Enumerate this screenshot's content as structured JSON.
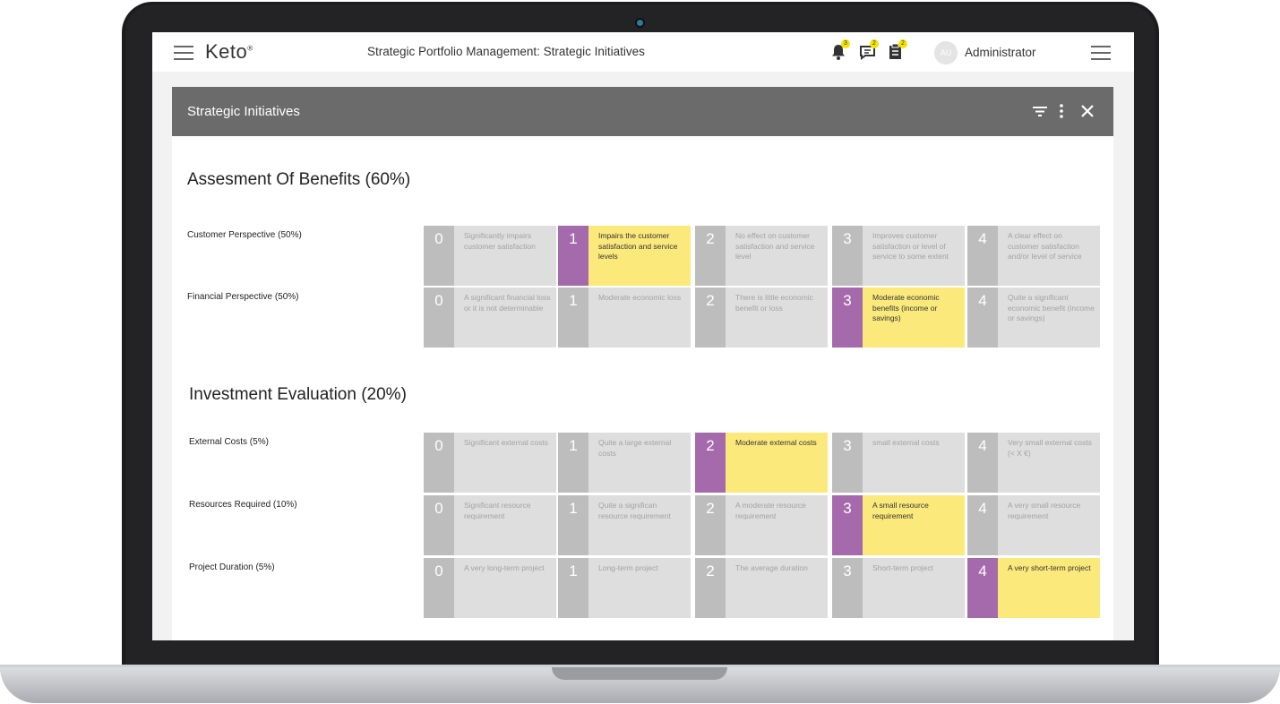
{
  "app": {
    "logo": "Keto",
    "logo_mark": "®",
    "title": "Strategic Portfolio Management: Strategic Initiatives",
    "notifications": {
      "bell": "3",
      "messages": "2",
      "tasks": "2"
    },
    "user": {
      "initials": "AU",
      "name": "Administrator"
    }
  },
  "panel": {
    "title": "Strategic Initiatives"
  },
  "sections": [
    {
      "title": "Assesment Of Benefits (60%)",
      "criteria": [
        {
          "label": "Customer Perspective (50%)",
          "selected": 1,
          "options": [
            {
              "score": "0",
              "text": "Significantly impairs customer satisfaction"
            },
            {
              "score": "1",
              "text": "Impairs the customer satisfaction and service levels"
            },
            {
              "score": "2",
              "text": "No effect on customer satisfaction and service level"
            },
            {
              "score": "3",
              "text": "Improves customer satisfaction or level of service to some extent"
            },
            {
              "score": "4",
              "text": "A clear effect on customer satisfaction and/or level of service"
            }
          ]
        },
        {
          "label": "Financial Perspective (50%)",
          "selected": 3,
          "options": [
            {
              "score": "0",
              "text": "A significant financial loss or it is not determinable"
            },
            {
              "score": "1",
              "text": "Moderate economic loss"
            },
            {
              "score": "2",
              "text": "There is little economic benefit or loss"
            },
            {
              "score": "3",
              "text": "Moderate economic benefits (income or savings)"
            },
            {
              "score": "4",
              "text": "Quite a significant economic benefit (income or savings)"
            }
          ]
        }
      ]
    },
    {
      "title": "Investment Evaluation (20%)",
      "criteria": [
        {
          "label": "External Costs (5%)",
          "selected": 2,
          "options": [
            {
              "score": "0",
              "text": "Significant external costs"
            },
            {
              "score": "1",
              "text": "Quite a large external costs"
            },
            {
              "score": "2",
              "text": "Moderate external costs"
            },
            {
              "score": "3",
              "text": "small external costs"
            },
            {
              "score": "4",
              "text": "Very small external costs (< X €)"
            }
          ]
        },
        {
          "label": "Resources Required (10%)",
          "selected": 3,
          "options": [
            {
              "score": "0",
              "text": "Significant resource requirement"
            },
            {
              "score": "1",
              "text": "Quite a significan resource requirement"
            },
            {
              "score": "2",
              "text": "A moderate resource requirement"
            },
            {
              "score": "3",
              "text": "A small resource requirement"
            },
            {
              "score": "4",
              "text": "A very small resource requirement"
            }
          ]
        },
        {
          "label": "Project Duration (5%)",
          "selected": 4,
          "options": [
            {
              "score": "0",
              "text": "A very long-term project"
            },
            {
              "score": "1",
              "text": "Long-term project"
            },
            {
              "score": "2",
              "text": "The average duration"
            },
            {
              "score": "3",
              "text": "Short-term project"
            },
            {
              "score": "4",
              "text": "A very short-term project"
            }
          ]
        }
      ]
    }
  ],
  "colors": {
    "selected_number": "#a56aab",
    "selected_cell": "#fce97c",
    "header": "#6b6b6b",
    "cell": "#dedede",
    "number": "#bdbdbd"
  }
}
